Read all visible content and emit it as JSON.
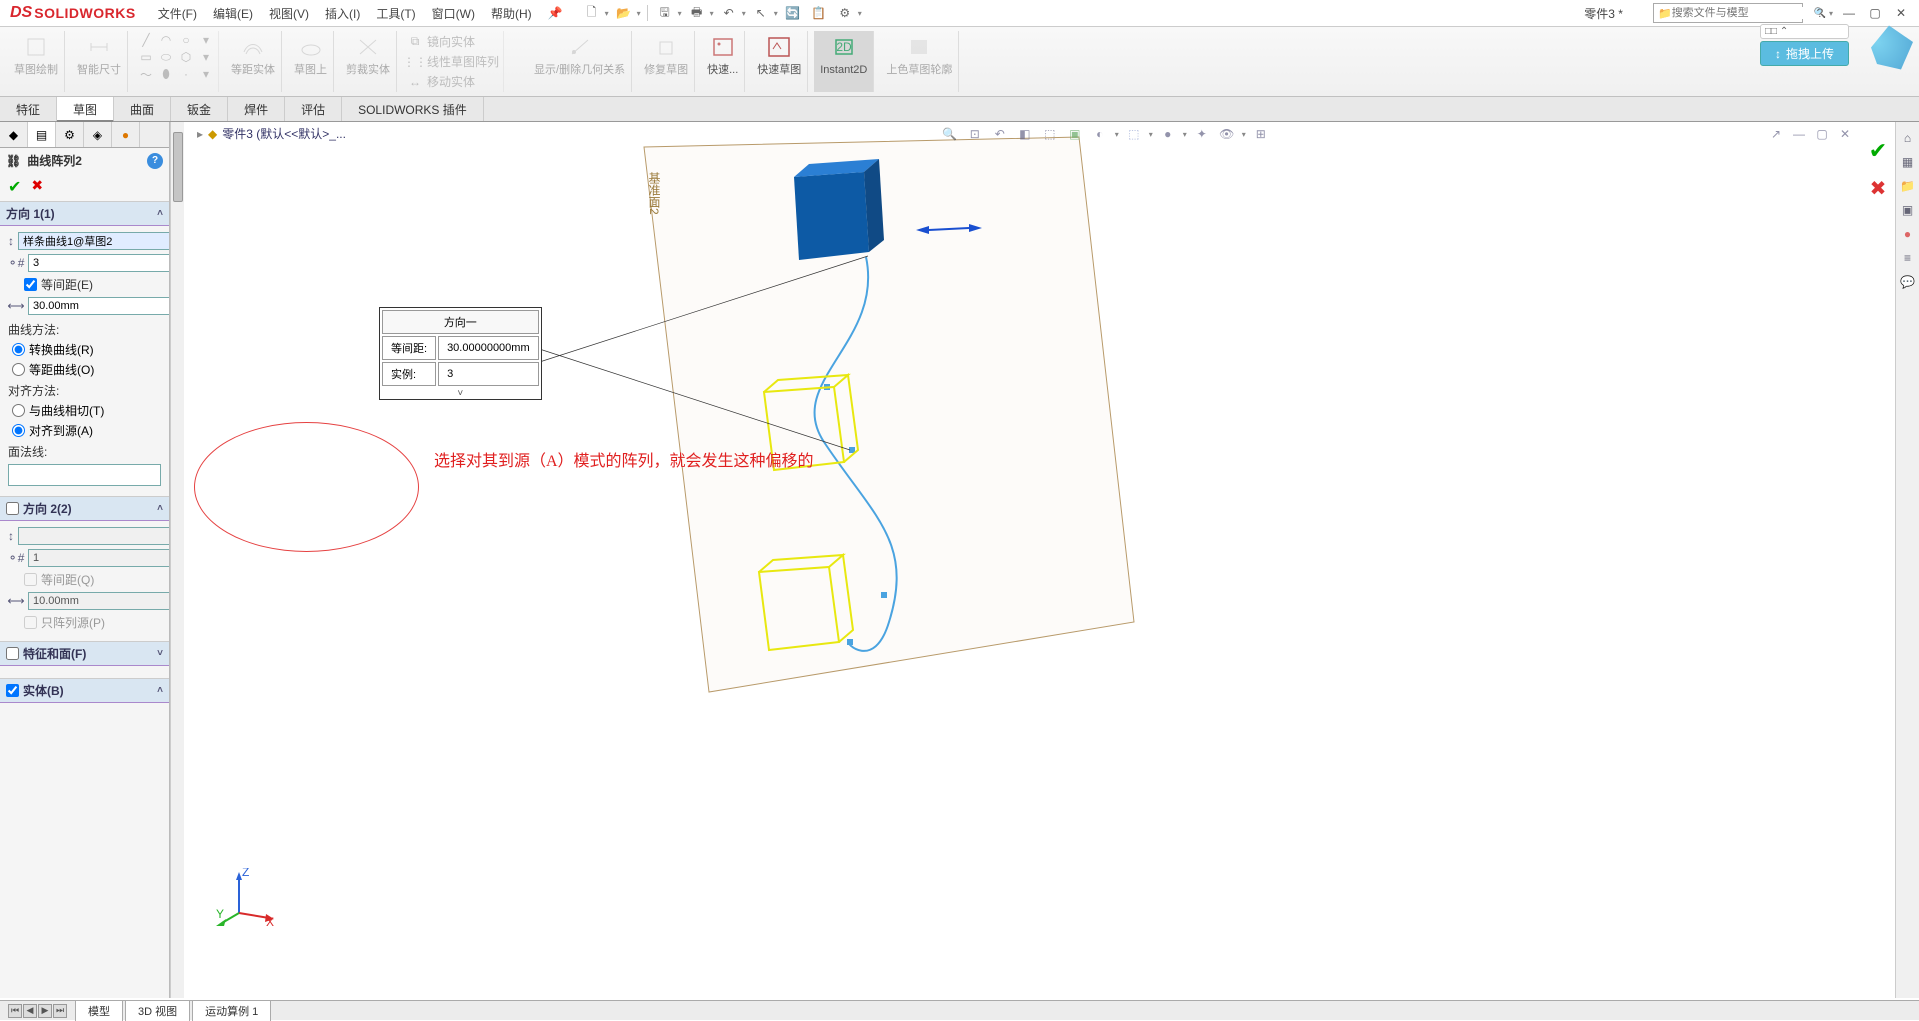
{
  "app": {
    "logo_ds": "DS",
    "logo_text": "SOLIDWORKS",
    "doc_title": "零件3 *"
  },
  "search": {
    "placeholder": "搜索文件与模型"
  },
  "upload": {
    "label": "拖拽上传"
  },
  "menu": [
    "文件(F)",
    "编辑(E)",
    "视图(V)",
    "插入(I)",
    "工具(T)",
    "窗口(W)",
    "帮助(H)"
  ],
  "ribbon": {
    "g1": [
      "草图绘制",
      "智能尺寸"
    ],
    "mid": [
      "等距实体",
      "草图上",
      "剪裁实体"
    ],
    "mirror_rows": [
      "镜向实体",
      "线性草图阵列",
      "移动实体"
    ],
    "right": [
      "显示/删除几何关系",
      "修复草图",
      "快速...",
      "快速草图",
      "Instant2D",
      "上色草图轮廓"
    ]
  },
  "tabs": [
    "特征",
    "草图",
    "曲面",
    "钣金",
    "焊件",
    "评估",
    "SOLIDWORKS 插件"
  ],
  "breadcrumb": {
    "doc": "零件3 (默认<<默认>_..."
  },
  "propmgr": {
    "title": "曲线阵列2",
    "dir1": {
      "header": "方向 1(1)",
      "curve": "样条曲线1@草图2",
      "count": "3",
      "eq_spacing": "等间距(E)",
      "spacing": "30.00mm",
      "curve_method": "曲线方法:",
      "transform": "转换曲线(R)",
      "offset_curve": "等距曲线(O)",
      "align_method": "对齐方法:",
      "tangent": "与曲线相切(T)",
      "align_seed": "对齐到源(A)",
      "normal": "面法线:"
    },
    "dir2": {
      "header": "方向 2(2)",
      "count": "1",
      "eq_spacing": "等间距(Q)",
      "spacing": "10.00mm",
      "seed_only": "只阵列源(P)"
    },
    "feat_faces": "特征和面(F)",
    "bodies": "实体(B)"
  },
  "float_table": {
    "title": "方向一",
    "r1k": "等间距:",
    "r1v": "30.00000000mm",
    "r2k": "实例:",
    "r2v": "3"
  },
  "annotation": "选择对其到源（A）模式的阵列，就会发生这种偏移的",
  "plane_label": "基准面2",
  "triad": {
    "x": "X",
    "y": "Y",
    "z": "Z"
  },
  "bottom_tabs": [
    "模型",
    "3D 视图",
    "运动算例 1"
  ]
}
